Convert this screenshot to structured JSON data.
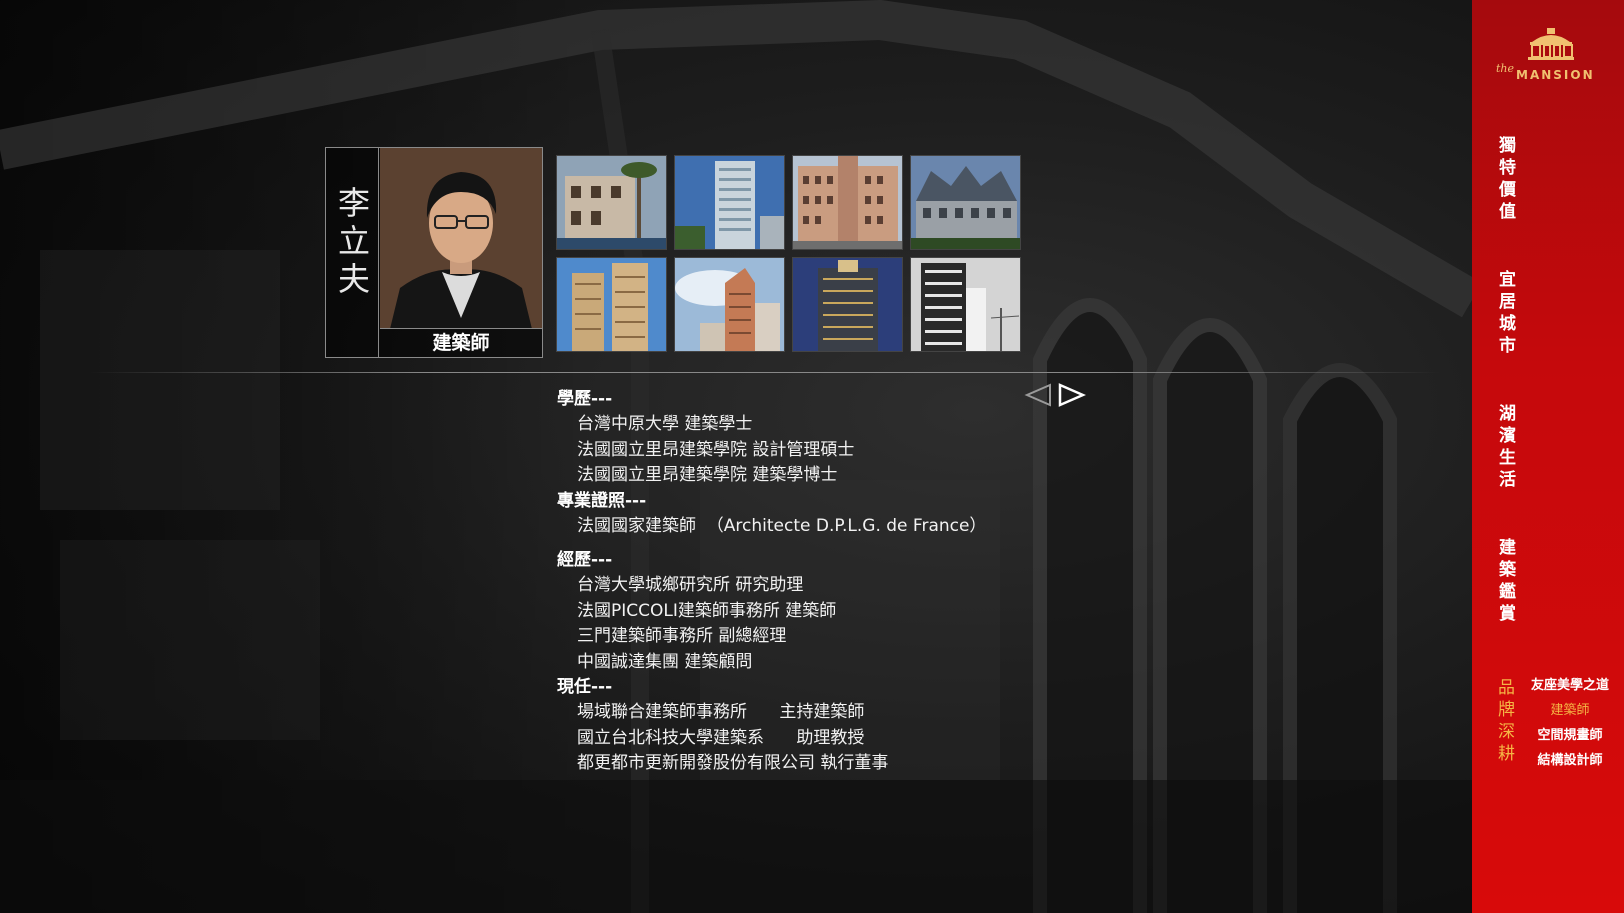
{
  "architect": {
    "name": "李立夫",
    "title": "建築師"
  },
  "gallery": [
    {
      "name": "project-photo-1"
    },
    {
      "name": "project-photo-2"
    },
    {
      "name": "project-photo-3"
    },
    {
      "name": "project-photo-4"
    },
    {
      "name": "project-photo-5"
    },
    {
      "name": "project-photo-6"
    },
    {
      "name": "project-photo-7"
    },
    {
      "name": "project-photo-8"
    }
  ],
  "nav": {
    "prev_icon": "triangle-left-outline-icon",
    "next_icon": "triangle-right-outline-icon"
  },
  "bio": {
    "education": {
      "heading": "學歷---",
      "items": [
        "台灣中原大學 建築學士",
        "法國國立里昂建築學院 設計管理碩士",
        "法國國立里昂建築學院 建築學博士"
      ]
    },
    "license": {
      "heading": "專業證照---",
      "items": [
        "法國國家建築師  （Architecte D.P.L.G. de France）"
      ]
    },
    "experience": {
      "heading": "經歷---",
      "items": [
        "台灣大學城鄉研究所 研究助理",
        "法國PICCOLI建築師事務所 建築師",
        "三門建築師事務所 副總經理",
        "中國誠達集團 建築顧問"
      ]
    },
    "current": {
      "heading": "現任---",
      "items": [
        "場域聯合建築師事務所      主持建築師",
        "國立台北科技大學建築系      助理教授",
        "都更都市更新開發股份有限公司 執行董事"
      ]
    }
  },
  "sidebar": {
    "logo_the": "the",
    "logo_text": "MANSION",
    "menu": [
      "獨特價值",
      "宜居城市",
      "湖濱生活",
      "建築鑑賞"
    ],
    "brand": {
      "label": "品牌深耕",
      "subitems": [
        "友座美學之道",
        "建築師",
        "空間規畫師",
        "結構設計師"
      ],
      "active_index": 1
    }
  },
  "colors": {
    "sidebar_red": "#c5090c",
    "accent_gold": "#f5b545",
    "text_white": "#ffffff"
  }
}
